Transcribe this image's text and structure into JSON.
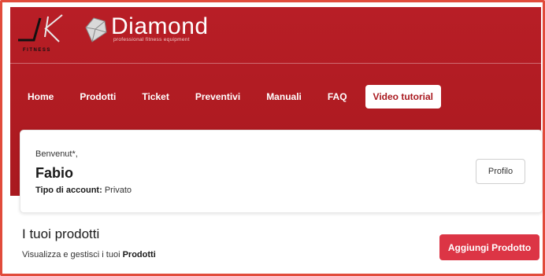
{
  "brand": {
    "jk_sub": "FITNESS",
    "diamond_word": "Diamond",
    "diamond_tagline": "professional fitness equipment"
  },
  "nav": {
    "items": [
      {
        "label": "Home"
      },
      {
        "label": "Prodotti"
      },
      {
        "label": "Ticket"
      },
      {
        "label": "Preventivi"
      },
      {
        "label": "Manuali"
      },
      {
        "label": "FAQ"
      },
      {
        "label": "Video tutorial",
        "active": true
      }
    ]
  },
  "welcome": {
    "greeting": "Benvenut*,",
    "name": "Fabio",
    "account_label": "Tipo di account:",
    "account_value": "Privato",
    "profile_button": "Profilo"
  },
  "products": {
    "title": "I tuoi prodotti",
    "subtitle_prefix": "Visualizza e gestisci i tuoi",
    "subtitle_strong": "Prodotti",
    "add_button": "Aggiungi Prodotto"
  },
  "colors": {
    "header_red": "#b81e26",
    "accent_button": "#dc3545",
    "frame_border": "#e14b3b"
  }
}
